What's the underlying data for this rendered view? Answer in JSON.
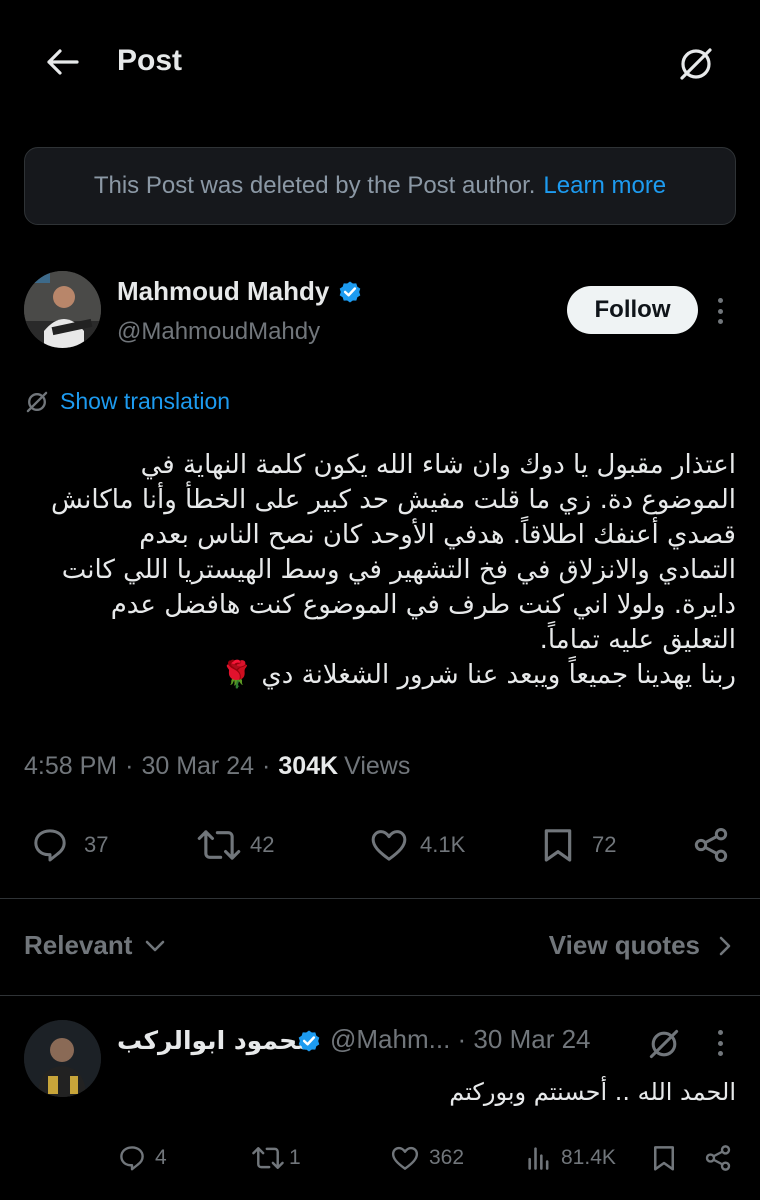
{
  "header": {
    "title": "Post"
  },
  "notice": {
    "text": "This Post was deleted by the Post author.",
    "link": "Learn more"
  },
  "author": {
    "name": "Mahmoud Mahdy",
    "handle": "@MahmoudMahdy",
    "follow_label": "Follow"
  },
  "translate_label": "Show translation",
  "tweet": {
    "lines": [
      "اعتذار مقبول يا دوك وان شاء الله يكون كلمة النهاية في",
      "الموضوع دة. زي ما قلت مفيش حد كبير على الخطأ وأنا ماكانش",
      "قصدي أعنفك اطلاقاً. هدفي الأوحد كان نصح الناس بعدم",
      "التمادي والانزلاق في فخ التشهير في وسط الهيستريا اللي كانت",
      "دايرة. ولولا اني كنت طرف في الموضوع كنت هافضل عدم",
      "التعليق عليه تماماً.",
      "ربنا يهدينا جميعاً ويبعد عنا شرور الشغلانة دي 🌹"
    ]
  },
  "meta": {
    "time": "4:58 PM",
    "date": "30 Mar 24",
    "views_count": "304K",
    "views_label": "Views",
    "dot": "·"
  },
  "actions": {
    "replies": "37",
    "reposts": "42",
    "likes": "4.1K",
    "bookmarks": "72"
  },
  "sort": {
    "label": "Relevant",
    "quotes_label": "View quotes"
  },
  "reply": {
    "name": "محمود ابوالركب",
    "handle": "@Mahm...",
    "date": "· 30 Mar 24",
    "text": "الحمد الله .. أحسنتم وبوركتم",
    "replies": "4",
    "reposts": "1",
    "likes": "362",
    "views": "81.4K"
  },
  "colors": {
    "accent": "#1d9bf0",
    "muted": "#71767b",
    "bg": "#000000",
    "text": "#e7e9ea",
    "verified": "#1d9bf0",
    "rose": "#c4121a"
  }
}
